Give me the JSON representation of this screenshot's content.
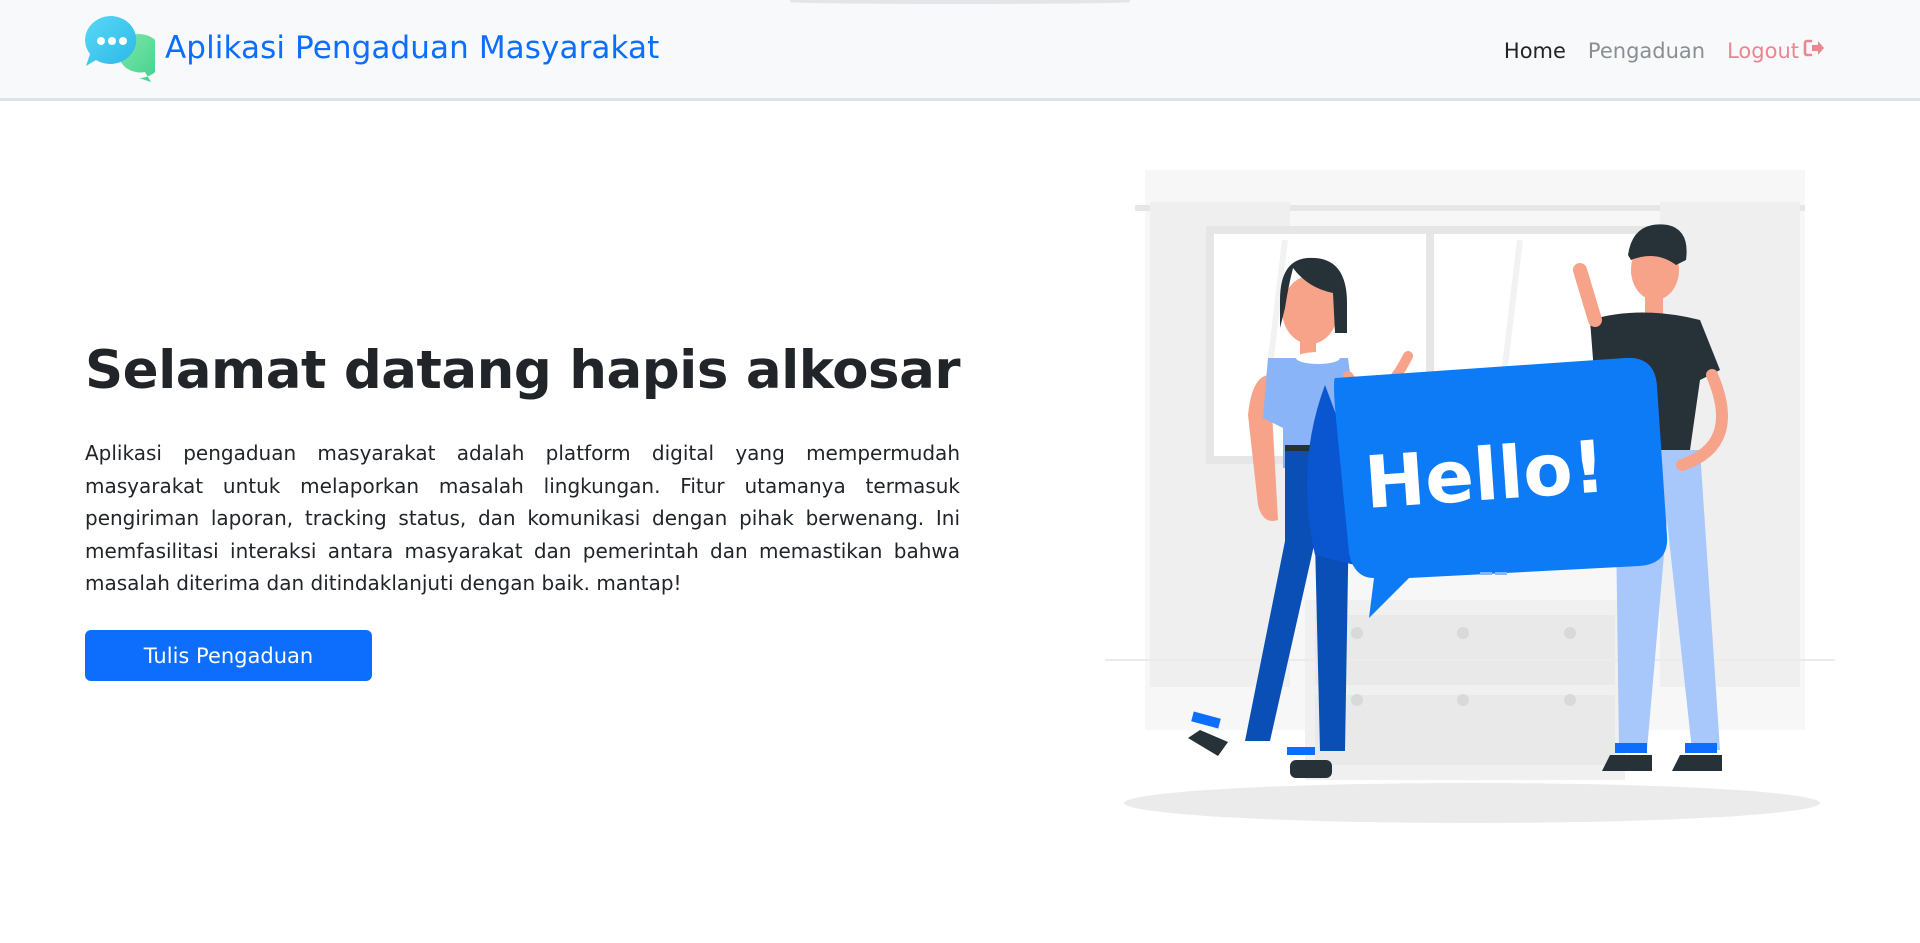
{
  "header": {
    "brand_title": "Aplikasi Pengaduan Masyarakat",
    "brand_icon": "chat-bubbles-icon",
    "nav": {
      "home": "Home",
      "pengaduan": "Pengaduan",
      "logout": "Logout",
      "logout_icon": "sign-out-icon"
    }
  },
  "main": {
    "greeting": "Selamat datang hapis alkosar",
    "description": "Aplikasi pengaduan masyarakat adalah platform digital yang mempermudah masyarakat untuk melaporkan masalah lingkungan. Fitur utamanya termasuk pengiriman laporan, tracking status, dan komunikasi dengan pihak berwenang. Ini memfasilitasi interaksi antara masyarakat dan pemerintah dan memastikan bahwa masalah diterima dan ditindaklanjuti dengan baik. mantap!",
    "cta_label": "Tulis Pengaduan"
  },
  "illustration": {
    "bubble_text": "Hello!"
  },
  "colors": {
    "primary": "#0d6efd",
    "navbar_bg": "#f8f9fa",
    "logout": "#ea868f",
    "muted_link": "#8a8f94"
  }
}
